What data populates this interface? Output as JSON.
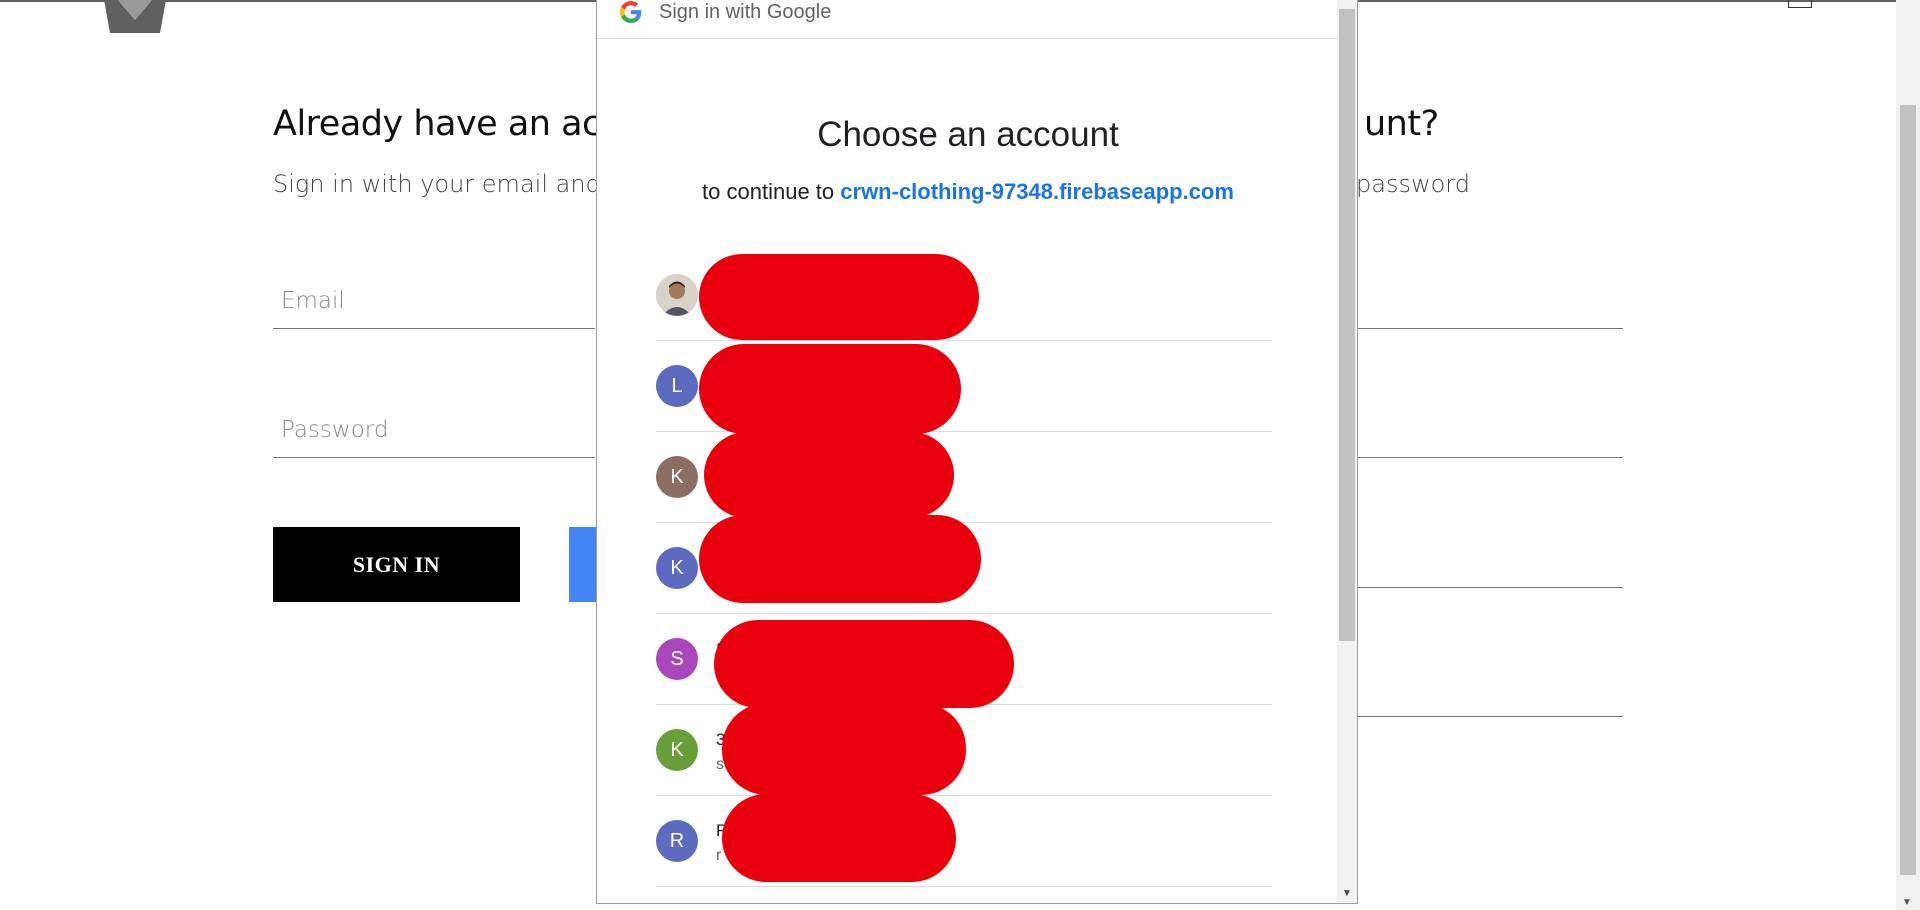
{
  "background_page": {
    "signin_heading_fragment": "Already have an acco",
    "signup_heading_fragment": "unt?",
    "signin_sub_fragment": "Sign in with your email and pa",
    "signup_sub_fragment": "password",
    "email_placeholder": "Email",
    "password_placeholder": "Password",
    "signin_button": "SIGN IN"
  },
  "popup": {
    "header_title": "Sign in with Google",
    "heading": "Choose an account",
    "continue_prefix": "to continue to ",
    "continue_domain": "crwn-clothing-97348.firebaseapp.com",
    "accounts": [
      {
        "initial": "",
        "avatar_color": "#cfc9c0",
        "name": "",
        "email": ""
      },
      {
        "initial": "L",
        "avatar_color": "#5c6bc0",
        "name": "",
        "email": ""
      },
      {
        "initial": "K",
        "avatar_color": "#8d6e63",
        "name": "",
        "email": ""
      },
      {
        "initial": "K",
        "avatar_color": "#5c6bc0",
        "name": "",
        "email": ""
      },
      {
        "initial": "S",
        "avatar_color": "#ab47bc",
        "name": "S",
        "email": "s"
      },
      {
        "initial": "K",
        "avatar_color": "#689f38",
        "name": "3",
        "email": "s"
      },
      {
        "initial": "R",
        "avatar_color": "#5c6bc0",
        "name": "R",
        "email": "r"
      }
    ]
  },
  "colors": {
    "link_blue": "#1a73e8",
    "redaction_red": "#e9000d",
    "google_blue": "#4285f4"
  }
}
